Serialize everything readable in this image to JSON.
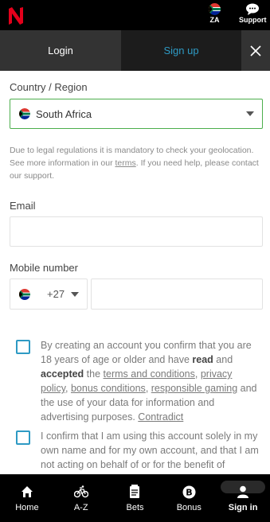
{
  "header": {
    "logo_icon": "netbet-n-logo",
    "region_label": "ZA",
    "support_label": "Support"
  },
  "tabs": {
    "login": "Login",
    "signup": "Sign up"
  },
  "country": {
    "label": "Country / Region",
    "value": "South Africa"
  },
  "notice": {
    "before_link": "Due to legal regulations it is mandatory to check your geolocation. See more information in our ",
    "link": "terms",
    "after_link": ". If you need help, please contact our support."
  },
  "email": {
    "label": "Email",
    "value": "",
    "placeholder": ""
  },
  "mobile": {
    "label": "Mobile number",
    "code": "+27",
    "value": ""
  },
  "terms": {
    "t1": "By creating an account you confirm that you are 18 years of age or older and have ",
    "read": "read",
    "and": " and ",
    "accepted": "accepted",
    "the": " the ",
    "terms_link": "terms and conditions",
    "comma1": ", ",
    "privacy_link": "privacy policy",
    "comma2": ", ",
    "bonus_link": "bonus conditions",
    "comma3": ", ",
    "gaming_link": "responsible gaming",
    "t2": " and the use of your data for information and advertising purposes. ",
    "contradict_link": "Contradict"
  },
  "confirm": {
    "text": "I confirm that I am using this account solely in my own name and for my own account, and that I am not acting on behalf of or for the benefit of"
  },
  "bottom_nav": {
    "home": "Home",
    "az": "A-Z",
    "bets": "Bets",
    "bonus": "Bonus",
    "signin": "Sign in"
  },
  "colors": {
    "accent": "#2e9ac4",
    "brand_red": "#e3001b",
    "valid_green": "#4cae4c"
  }
}
